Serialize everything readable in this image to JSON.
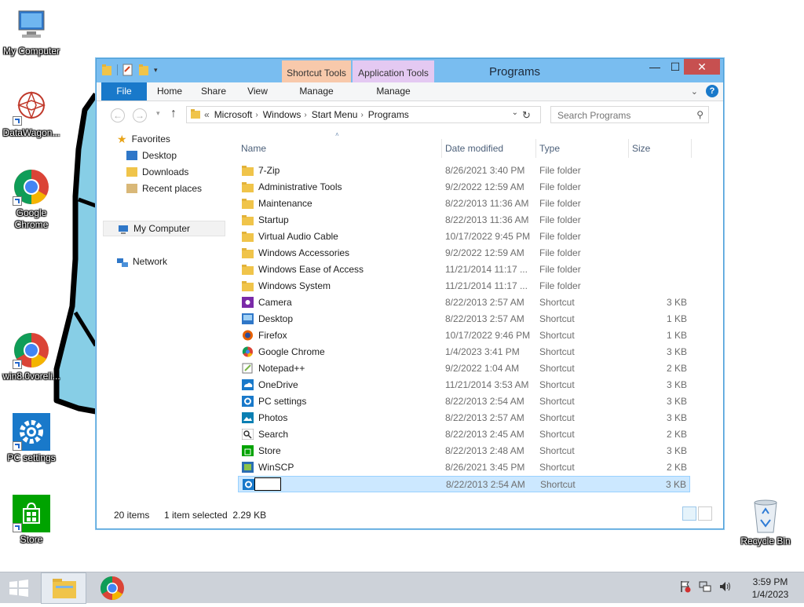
{
  "desktop": {
    "icons": [
      {
        "label": "My Computer"
      },
      {
        "label": "DataWagon..."
      },
      {
        "label": "Google Chrome"
      },
      {
        "label": "win8.0voreli..."
      },
      {
        "label": "PC settings"
      },
      {
        "label": "Store"
      },
      {
        "label": "Recycle Bin"
      }
    ]
  },
  "window": {
    "title": "Programs",
    "context_tabs": {
      "shortcut_tools": "Shortcut Tools",
      "application_tools": "Application Tools"
    },
    "ribbon_tabs": [
      "File",
      "Home",
      "Share",
      "View",
      "Manage",
      "Manage"
    ],
    "controls": {
      "minimize": "—",
      "maximize": "☐",
      "close": "✕"
    },
    "address": {
      "prefix": "«",
      "crumbs": [
        "Microsoft",
        "Windows",
        "Start Menu",
        "Programs"
      ]
    },
    "search": {
      "placeholder": "Search Programs"
    },
    "nav_pane": {
      "favorites": "Favorites",
      "favorites_items": [
        "Desktop",
        "Downloads",
        "Recent places"
      ],
      "my_computer": "My Computer",
      "network": "Network"
    },
    "columns": [
      "Name",
      "Date modified",
      "Type",
      "Size"
    ],
    "files": [
      {
        "name": "7-Zip",
        "date": "8/26/2021 3:40 PM",
        "type": "File folder",
        "size": "",
        "kind": "folder"
      },
      {
        "name": "Administrative Tools",
        "date": "9/2/2022 12:59 AM",
        "type": "File folder",
        "size": "",
        "kind": "folder"
      },
      {
        "name": "Maintenance",
        "date": "8/22/2013 11:36 AM",
        "type": "File folder",
        "size": "",
        "kind": "folder"
      },
      {
        "name": "Startup",
        "date": "8/22/2013 11:36 AM",
        "type": "File folder",
        "size": "",
        "kind": "folder"
      },
      {
        "name": "Virtual Audio Cable",
        "date": "10/17/2022 9:45 PM",
        "type": "File folder",
        "size": "",
        "kind": "folder"
      },
      {
        "name": "Windows Accessories",
        "date": "9/2/2022 12:59 AM",
        "type": "File folder",
        "size": "",
        "kind": "folder"
      },
      {
        "name": "Windows Ease of Access",
        "date": "11/21/2014 11:17 ...",
        "type": "File folder",
        "size": "",
        "kind": "folder"
      },
      {
        "name": "Windows System",
        "date": "11/21/2014 11:17 ...",
        "type": "File folder",
        "size": "",
        "kind": "folder"
      },
      {
        "name": "Camera",
        "date": "8/22/2013 2:57 AM",
        "type": "Shortcut",
        "size": "3 KB",
        "kind": "camera"
      },
      {
        "name": "Desktop",
        "date": "8/22/2013 2:57 AM",
        "type": "Shortcut",
        "size": "1 KB",
        "kind": "desktop"
      },
      {
        "name": "Firefox",
        "date": "10/17/2022 9:46 PM",
        "type": "Shortcut",
        "size": "1 KB",
        "kind": "firefox"
      },
      {
        "name": "Google Chrome",
        "date": "1/4/2023 3:41 PM",
        "type": "Shortcut",
        "size": "3 KB",
        "kind": "chrome"
      },
      {
        "name": "Notepad++",
        "date": "9/2/2022 1:04 AM",
        "type": "Shortcut",
        "size": "2 KB",
        "kind": "notepad"
      },
      {
        "name": "OneDrive",
        "date": "11/21/2014 3:53 AM",
        "type": "Shortcut",
        "size": "3 KB",
        "kind": "onedrive"
      },
      {
        "name": "PC settings",
        "date": "8/22/2013 2:54 AM",
        "type": "Shortcut",
        "size": "3 KB",
        "kind": "settings"
      },
      {
        "name": "Photos",
        "date": "8/22/2013 2:57 AM",
        "type": "Shortcut",
        "size": "3 KB",
        "kind": "photos"
      },
      {
        "name": "Search",
        "date": "8/22/2013 2:45 AM",
        "type": "Shortcut",
        "size": "2 KB",
        "kind": "search"
      },
      {
        "name": "Store",
        "date": "8/22/2013 2:48 AM",
        "type": "Shortcut",
        "size": "3 KB",
        "kind": "store"
      },
      {
        "name": "WinSCP",
        "date": "8/26/2021 3:45 PM",
        "type": "Shortcut",
        "size": "2 KB",
        "kind": "winscp"
      },
      {
        "name": "",
        "date": "8/22/2013 2:54 AM",
        "type": "Shortcut",
        "size": "3 KB",
        "kind": "settings",
        "selected": true,
        "renaming": true
      }
    ],
    "status": {
      "count": "20 items",
      "selection": "1 item selected  2.29 KB"
    }
  },
  "taskbar": {
    "time": "3:59 PM",
    "date": "1/4/2023"
  },
  "colors": {
    "accent": "#1979ca",
    "title_bar": "#79bdf0",
    "selection": "#cce8ff",
    "desktop_art": "#87cee6"
  }
}
